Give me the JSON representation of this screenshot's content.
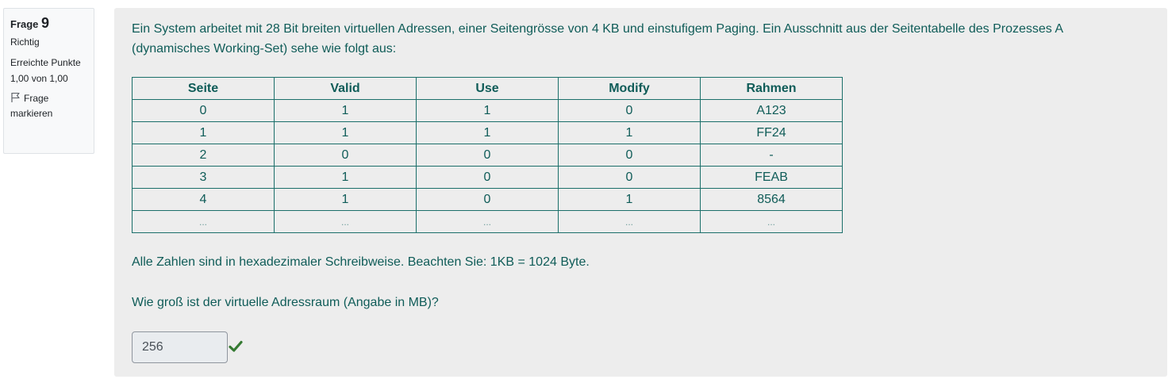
{
  "info": {
    "frage_label": "Frage",
    "frage_number": "9",
    "state": "Richtig",
    "grade": "Erreichte Punkte 1,00 von 1,00",
    "flag_label": "Frage markieren"
  },
  "question": {
    "text": "Ein System arbeitet mit 28 Bit breiten virtuellen Adressen, einer Seitengrösse von 4 KB und einstufigem Paging. Ein Ausschnitt aus der Seitentabelle des Prozesses A (dynamisches Working-Set) sehe wie folgt aus:",
    "note": "Alle Zahlen sind in hexadezimaler Schreibweise. Beachten Sie: 1KB = 1024 Byte.",
    "prompt": "Wie groß ist der virtuelle Adressraum (Angabe in MB)?",
    "answer_value": "256",
    "answer_status": "correct",
    "text_color": "#0f5c58",
    "check_color": "#357a32"
  },
  "table": {
    "headers": [
      "Seite",
      "Valid",
      "Use",
      "Modify",
      "Rahmen"
    ],
    "rows": [
      [
        "0",
        "1",
        "1",
        "0",
        "A123"
      ],
      [
        "1",
        "1",
        "1",
        "1",
        "FF24"
      ],
      [
        "2",
        "0",
        "0",
        "0",
        "-"
      ],
      [
        "3",
        "1",
        "0",
        "0",
        "FEAB"
      ],
      [
        "4",
        "1",
        "0",
        "1",
        "8564"
      ],
      [
        "...",
        "...",
        "...",
        "...",
        "..."
      ]
    ]
  },
  "icons": {
    "flag": "flag-icon",
    "check": "check-icon"
  }
}
